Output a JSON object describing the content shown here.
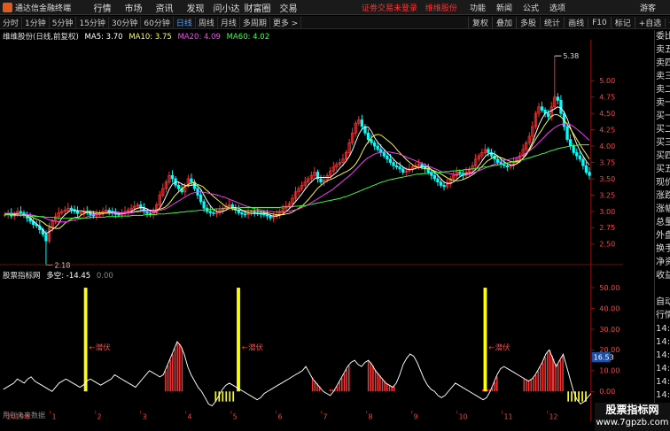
{
  "app": {
    "title": "通达信金融终端",
    "menu": [
      "行情",
      "市场",
      "资讯",
      "发现",
      "问小达",
      "财富圈",
      "交易"
    ],
    "alert_text": "证劵交易未登录",
    "alert_stock": "维维股份",
    "right_menu": [
      "功能",
      "新闻",
      "公式",
      "选项"
    ],
    "guest": "游客"
  },
  "toolbar": {
    "timeframes": [
      "分时",
      "1分钟",
      "5分钟",
      "15分钟",
      "30分钟",
      "60分钟",
      "日线",
      "周线",
      "月线",
      "多周期",
      "更多 >"
    ],
    "active_index": 6,
    "tools": [
      "复权",
      "叠加",
      "多股",
      "统计",
      "画线",
      "F10",
      "标记",
      "+自选",
      "◁"
    ]
  },
  "main_chart": {
    "stock_label": "维维股份(日线,前复权)",
    "ma": [
      {
        "label": "MA5: 3.70",
        "color": "#ffffff"
      },
      {
        "label": "MA10: 3.75",
        "color": "#ffff40"
      },
      {
        "label": "MA20: 4.09",
        "color": "#ff40ff"
      },
      {
        "label": "MA60: 4.02",
        "color": "#40ff40"
      }
    ],
    "price_min": 2.25,
    "price_max": 5.5,
    "y_ticks": [
      "5.00",
      "4.75",
      "4.50",
      "4.25",
      "4.00",
      "3.75",
      "3.50",
      "3.25",
      "3.00",
      "2.75",
      "2.50"
    ],
    "y_tick_values": [
      5.0,
      4.75,
      4.5,
      4.25,
      4.0,
      3.75,
      3.5,
      3.25,
      3.0,
      2.75,
      2.5
    ],
    "high_label": "5.38",
    "high_value": 5.38,
    "low_label": "2.18",
    "low_value": 2.18,
    "close_series": [
      2.95,
      2.97,
      2.93,
      2.96,
      3.0,
      2.98,
      2.94,
      2.9,
      2.85,
      2.8,
      2.78,
      2.72,
      2.65,
      2.55,
      2.75,
      2.85,
      2.92,
      2.98,
      3.0,
      3.02,
      3.05,
      3.03,
      3.0,
      2.97,
      2.98,
      3.0,
      2.98,
      2.95,
      2.93,
      2.95,
      2.98,
      3.0,
      3.02,
      3.0,
      2.97,
      2.96,
      2.95,
      2.98,
      3.0,
      3.02,
      3.05,
      3.08,
      3.1,
      3.05,
      3.0,
      2.97,
      2.95,
      2.98,
      3.1,
      3.25,
      3.35,
      3.45,
      3.55,
      3.5,
      3.4,
      3.35,
      3.3,
      3.4,
      3.5,
      3.45,
      3.35,
      3.25,
      3.15,
      3.05,
      3.0,
      2.98,
      2.97,
      2.98,
      3.02,
      3.05,
      3.08,
      3.1,
      3.05,
      3.02,
      2.98,
      2.96,
      2.95,
      2.97,
      2.99,
      2.98,
      2.97,
      2.96,
      2.95,
      2.93,
      2.9,
      2.92,
      2.95,
      3.0,
      3.05,
      3.08,
      3.12,
      3.2,
      3.3,
      3.35,
      3.4,
      3.45,
      3.5,
      3.55,
      3.6,
      3.5,
      3.45,
      3.48,
      3.55,
      3.62,
      3.68,
      3.72,
      3.75,
      3.8,
      3.9,
      4.05,
      4.2,
      4.35,
      4.4,
      4.3,
      4.2,
      4.1,
      4.05,
      4.0,
      3.95,
      3.9,
      3.85,
      3.8,
      3.75,
      3.7,
      3.68,
      3.65,
      3.6,
      3.62,
      3.65,
      3.68,
      3.7,
      3.72,
      3.68,
      3.65,
      3.6,
      3.55,
      3.5,
      3.45,
      3.4,
      3.38,
      3.42,
      3.5,
      3.55,
      3.6,
      3.58,
      3.55,
      3.6,
      3.65,
      3.7,
      3.8,
      3.85,
      3.9,
      3.95,
      3.9,
      3.85,
      3.8,
      3.75,
      3.72,
      3.7,
      3.68,
      3.7,
      3.75,
      3.8,
      3.85,
      3.95,
      4.05,
      4.15,
      4.3,
      4.5,
      4.6,
      4.55,
      4.5,
      4.45,
      4.6,
      4.75,
      4.7,
      4.5,
      4.3,
      4.1,
      4.0,
      3.9,
      3.85,
      3.8,
      3.7,
      3.6,
      3.55
    ],
    "ma5_series": [
      2.96,
      2.96,
      2.95,
      2.95,
      2.96,
      2.96,
      2.95,
      2.93,
      2.9,
      2.85,
      2.81,
      2.77,
      2.72,
      2.66,
      2.69,
      2.72,
      2.76,
      2.81,
      2.9,
      2.95,
      2.99,
      3.02,
      3.02,
      3.01,
      3.01,
      3.0,
      2.99,
      2.98,
      2.97,
      2.96,
      2.96,
      2.96,
      2.98,
      2.99,
      2.99,
      2.99,
      2.98,
      2.97,
      2.97,
      2.98,
      3.0,
      3.03,
      3.05,
      3.06,
      3.06,
      3.04,
      3.01,
      2.99,
      3.0,
      3.05,
      3.13,
      3.23,
      3.34,
      3.42,
      3.45,
      3.45,
      3.42,
      3.4,
      3.39,
      3.4,
      3.41,
      3.39,
      3.34,
      3.25,
      3.16,
      3.09,
      3.03,
      3.0,
      2.99,
      3.0,
      3.02,
      3.05,
      3.06,
      3.06,
      3.05,
      3.02,
      2.99,
      2.98,
      2.97,
      2.97,
      2.97,
      2.97,
      2.97,
      2.96,
      2.94,
      2.93,
      2.93,
      2.94,
      2.96,
      3.0,
      3.04,
      3.09,
      3.15,
      3.21,
      3.27,
      3.34,
      3.4,
      3.45,
      3.5,
      3.52,
      3.52,
      3.52,
      3.52,
      3.52,
      3.56,
      3.6,
      3.66,
      3.71,
      3.77,
      3.84,
      3.94,
      4.06,
      4.18,
      4.26,
      4.29,
      4.29,
      4.23,
      4.13,
      4.06,
      4.0,
      3.95,
      3.9,
      3.85,
      3.8,
      3.75,
      3.72,
      3.68,
      3.65,
      3.64,
      3.64,
      3.66,
      3.67,
      3.69,
      3.69,
      3.68,
      3.64,
      3.6,
      3.55,
      3.5,
      3.45,
      3.43,
      3.43,
      3.45,
      3.49,
      3.53,
      3.56,
      3.58,
      3.58,
      3.6,
      3.64,
      3.7,
      3.77,
      3.84,
      3.88,
      3.89,
      3.88,
      3.85,
      3.8,
      3.76,
      3.73,
      3.71,
      3.71,
      3.73,
      3.76,
      3.81,
      3.88,
      3.96,
      4.06,
      4.19,
      4.32,
      4.42,
      4.5,
      4.52,
      4.54,
      4.57,
      4.6,
      4.58,
      4.52,
      4.42,
      4.28,
      4.16,
      4.03,
      3.93,
      3.85,
      3.77,
      3.71
    ],
    "ma10_series": [
      2.96,
      2.96,
      2.96,
      2.96,
      2.96,
      2.96,
      2.95,
      2.94,
      2.93,
      2.9,
      2.88,
      2.86,
      2.83,
      2.79,
      2.77,
      2.75,
      2.74,
      2.74,
      2.78,
      2.83,
      2.86,
      2.89,
      2.91,
      2.91,
      2.95,
      2.97,
      3.0,
      3.0,
      2.99,
      2.98,
      2.98,
      2.98,
      2.98,
      2.98,
      2.98,
      2.97,
      2.97,
      2.97,
      2.98,
      2.99,
      2.99,
      3.0,
      3.01,
      3.02,
      3.02,
      3.02,
      3.02,
      3.02,
      3.03,
      3.04,
      3.06,
      3.1,
      3.16,
      3.23,
      3.28,
      3.33,
      3.37,
      3.4,
      3.43,
      3.44,
      3.42,
      3.4,
      3.38,
      3.33,
      3.29,
      3.24,
      3.2,
      3.16,
      3.12,
      3.08,
      3.06,
      3.04,
      3.03,
      3.02,
      3.02,
      3.01,
      3.01,
      3.01,
      3.01,
      3.01,
      3.0,
      2.99,
      2.98,
      2.97,
      2.96,
      2.95,
      2.95,
      2.95,
      2.96,
      2.97,
      2.99,
      3.02,
      3.05,
      3.08,
      3.13,
      3.18,
      3.24,
      3.3,
      3.36,
      3.4,
      3.44,
      3.47,
      3.49,
      3.51,
      3.54,
      3.56,
      3.59,
      3.61,
      3.64,
      3.68,
      3.74,
      3.82,
      3.92,
      4.01,
      4.08,
      4.14,
      4.17,
      4.18,
      4.16,
      4.12,
      4.08,
      4.04,
      3.99,
      3.93,
      3.88,
      3.83,
      3.78,
      3.74,
      3.7,
      3.68,
      3.67,
      3.66,
      3.66,
      3.65,
      3.63,
      3.61,
      3.59,
      3.56,
      3.53,
      3.5,
      3.48,
      3.47,
      3.47,
      3.48,
      3.5,
      3.52,
      3.55,
      3.58,
      3.62,
      3.67,
      3.72,
      3.77,
      3.8,
      3.83,
      3.84,
      3.83,
      3.81,
      3.79,
      3.77,
      3.76,
      3.76,
      3.77,
      3.8,
      3.85,
      3.92,
      4.0,
      4.09,
      4.17,
      4.24,
      4.32,
      4.39,
      4.45,
      4.48,
      4.48,
      4.45,
      4.4,
      4.34,
      4.27,
      4.19,
      4.11,
      4.03,
      3.95,
      3.88,
      3.8
    ],
    "ma20_series": [
      2.97,
      2.97,
      2.97,
      2.97,
      2.97,
      2.96,
      2.96,
      2.95,
      2.95,
      2.94,
      2.93,
      2.92,
      2.91,
      2.89,
      2.87,
      2.86,
      2.85,
      2.84,
      2.84,
      2.84,
      2.85,
      2.86,
      2.87,
      2.88,
      2.89,
      2.9,
      2.92,
      2.94,
      2.95,
      2.96,
      2.96,
      2.97,
      2.97,
      2.97,
      2.98,
      2.98,
      2.98,
      2.98,
      2.98,
      2.98,
      2.98,
      2.99,
      2.99,
      3.0,
      3.0,
      3.0,
      3.0,
      3.0,
      3.01,
      3.02,
      3.03,
      3.05,
      3.08,
      3.11,
      3.14,
      3.17,
      3.2,
      3.23,
      3.26,
      3.28,
      3.29,
      3.3,
      3.3,
      3.29,
      3.28,
      3.27,
      3.26,
      3.25,
      3.23,
      3.22,
      3.2,
      3.18,
      3.16,
      3.14,
      3.12,
      3.1,
      3.08,
      3.07,
      3.05,
      3.04,
      3.03,
      3.02,
      3.01,
      3.0,
      3.0,
      2.99,
      2.99,
      2.99,
      2.99,
      3.0,
      3.01,
      3.02,
      3.03,
      3.05,
      3.07,
      3.09,
      3.12,
      3.15,
      3.18,
      3.21,
      3.24,
      3.27,
      3.3,
      3.33,
      3.37,
      3.41,
      3.45,
      3.49,
      3.53,
      3.57,
      3.62,
      3.67,
      3.72,
      3.77,
      3.81,
      3.84,
      3.87,
      3.89,
      3.9,
      3.91,
      3.91,
      3.91,
      3.9,
      3.89,
      3.88,
      3.86,
      3.84,
      3.82,
      3.8,
      3.78,
      3.76,
      3.74,
      3.72,
      3.7,
      3.68,
      3.66,
      3.64,
      3.62,
      3.6,
      3.59,
      3.58,
      3.57,
      3.56,
      3.56,
      3.56,
      3.56,
      3.57,
      3.58,
      3.6,
      3.62,
      3.64,
      3.66,
      3.68,
      3.7,
      3.72,
      3.74,
      3.76,
      3.78,
      3.79,
      3.8,
      3.81,
      3.82,
      3.84,
      3.86,
      3.89,
      3.92,
      3.96,
      4.0,
      4.05,
      4.1,
      4.15,
      4.2,
      4.24,
      4.28,
      4.31,
      4.33,
      4.34,
      4.34,
      4.33,
      4.3,
      4.26,
      4.22,
      4.18,
      4.13,
      4.09
    ],
    "ma60_series": [
      2.95,
      2.95,
      2.95,
      2.94,
      2.94,
      2.94,
      2.94,
      2.93,
      2.93,
      2.93,
      2.92,
      2.92,
      2.92,
      2.91,
      2.91,
      2.91,
      2.9,
      2.9,
      2.9,
      2.9,
      2.9,
      2.9,
      2.9,
      2.9,
      2.9,
      2.9,
      2.9,
      2.91,
      2.91,
      2.91,
      2.91,
      2.91,
      2.92,
      2.92,
      2.92,
      2.92,
      2.93,
      2.93,
      2.93,
      2.93,
      2.94,
      2.94,
      2.94,
      2.94,
      2.95,
      2.95,
      2.95,
      2.95,
      2.96,
      2.96,
      2.96,
      2.97,
      2.97,
      2.98,
      2.98,
      2.99,
      2.99,
      3.0,
      3.0,
      3.01,
      3.01,
      3.02,
      3.02,
      3.03,
      3.03,
      3.03,
      3.04,
      3.04,
      3.04,
      3.05,
      3.05,
      3.05,
      3.05,
      3.05,
      3.06,
      3.06,
      3.06,
      3.06,
      3.06,
      3.06,
      3.06,
      3.06,
      3.06,
      3.06,
      3.06,
      3.06,
      3.06,
      3.07,
      3.07,
      3.07,
      3.07,
      3.08,
      3.08,
      3.09,
      3.09,
      3.1,
      3.11,
      3.12,
      3.13,
      3.14,
      3.15,
      3.16,
      3.17,
      3.18,
      3.19,
      3.2,
      3.22,
      3.23,
      3.25,
      3.27,
      3.29,
      3.31,
      3.33,
      3.35,
      3.37,
      3.39,
      3.41,
      3.43,
      3.45,
      3.46,
      3.48,
      3.49,
      3.5,
      3.51,
      3.52,
      3.53,
      3.54,
      3.55,
      3.56,
      3.57,
      3.57,
      3.58,
      3.58,
      3.59,
      3.59,
      3.6,
      3.6,
      3.6,
      3.61,
      3.61,
      3.62,
      3.62,
      3.63,
      3.63,
      3.64,
      3.64,
      3.65,
      3.65,
      3.66,
      3.67,
      3.68,
      3.68,
      3.69,
      3.7,
      3.71,
      3.72,
      3.73,
      3.74,
      3.75,
      3.76,
      3.77,
      3.78,
      3.79,
      3.8,
      3.82,
      3.83,
      3.85,
      3.86,
      3.88,
      3.89,
      3.91,
      3.93,
      3.94,
      3.96,
      3.97,
      3.98,
      3.99,
      4.0,
      4.01,
      4.01,
      4.02,
      4.02,
      4.02,
      4.02
    ]
  },
  "indicator": {
    "name": "股票指标网",
    "label": "多空: -14.45",
    "label_extra": "0.00",
    "y_ticks": [
      "50.00",
      "40.00",
      "30.00",
      "20.00",
      "10.00",
      "0.00"
    ],
    "y_tick_values": [
      50,
      40,
      30,
      20,
      10,
      0
    ],
    "ymin": -8,
    "ymax": 55,
    "current_value": "16.53",
    "current_num": 16.53,
    "signal_label": "潜伏",
    "signals": [
      0.14,
      0.4,
      0.82
    ],
    "no_data": "用到未来数据",
    "line_series": [
      1,
      2,
      3,
      4,
      6,
      5,
      4,
      6,
      7,
      5,
      4,
      3,
      2,
      1,
      0,
      2,
      4,
      5,
      6,
      5,
      4,
      3,
      2,
      3,
      5,
      6,
      5,
      4,
      3,
      4,
      5,
      6,
      8,
      7,
      6,
      5,
      4,
      3,
      2,
      4,
      6,
      8,
      10,
      9,
      8,
      7,
      8,
      12,
      16,
      20,
      24,
      22,
      18,
      12,
      8,
      5,
      2,
      0,
      -3,
      -6,
      -7,
      -5,
      -2,
      1,
      3,
      4,
      3,
      2,
      1,
      0,
      -1,
      -2,
      -3,
      -4,
      -3,
      -1,
      0,
      1,
      2,
      3,
      4,
      5,
      6,
      7,
      8,
      9,
      10,
      12,
      9,
      6,
      4,
      2,
      0,
      -1,
      -2,
      0,
      3,
      6,
      9,
      12,
      14,
      15,
      13,
      12,
      14,
      15,
      13,
      10,
      8,
      6,
      4,
      3,
      2,
      4,
      8,
      13,
      16,
      18,
      17,
      14,
      10,
      6,
      3,
      1,
      0,
      -2,
      -3,
      -2,
      0,
      2,
      4,
      3,
      2,
      1,
      0,
      -1,
      -2,
      -3,
      -4,
      -3,
      0,
      4,
      8,
      11,
      12,
      11,
      10,
      9,
      8,
      7,
      6,
      5,
      6,
      8,
      11,
      14,
      18,
      20,
      16,
      12,
      15,
      18,
      12,
      6,
      0,
      -4,
      -6,
      -5,
      -3,
      -1
    ],
    "red_ranges": [
      [
        0.275,
        0.305
      ],
      [
        0.525,
        0.54
      ],
      [
        0.555,
        0.59
      ],
      [
        0.62,
        0.665
      ],
      [
        0.815,
        0.84
      ],
      [
        0.885,
        0.935
      ],
      [
        0.935,
        0.955
      ]
    ],
    "yellow_ranges": [
      [
        0.36,
        0.39
      ],
      [
        0.96,
        0.99
      ]
    ]
  },
  "x_axis": [
    "2019年",
    "1",
    "2",
    "3",
    "4",
    "5",
    "6",
    "7",
    "8",
    "9",
    "10",
    "11",
    "12"
  ],
  "right_panel_top": [
    "委比",
    "卖五",
    "卖四",
    "卖三",
    "卖二",
    "卖一",
    "买一",
    "买二",
    "买三",
    "买四",
    "买五",
    "现价",
    "涨跌",
    "涨幅",
    "总量",
    "外盘",
    "换手",
    "净资",
    "收益"
  ],
  "right_panel_bottom": [
    "自动",
    "行情",
    "14:56",
    "14:56",
    "14:56",
    "14:56",
    "14:56",
    "14:56",
    "14:56",
    "14:56",
    "14:56"
  ],
  "watermark": {
    "line1": "股票指标网",
    "line2": "www.7gpzb.com"
  },
  "colors": {
    "up": "#ff3232",
    "down": "#00ffff",
    "signal": "#ffff00",
    "active": "#4da3ff"
  }
}
